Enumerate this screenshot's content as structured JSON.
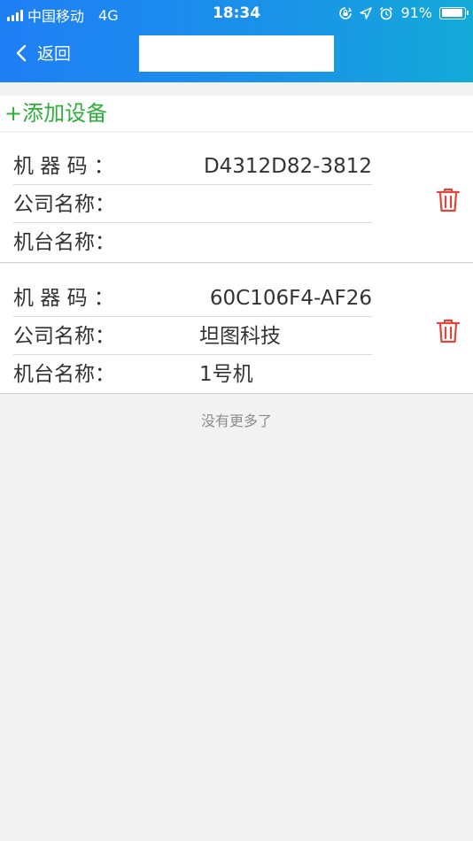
{
  "status_bar": {
    "carrier": "中国移动",
    "network": "4G",
    "time": "18:34",
    "battery": "91%"
  },
  "nav": {
    "back_label": "返回"
  },
  "add_device": {
    "label": "+添加设备"
  },
  "devices": [
    {
      "machine_code_label": "机 器 码 ：",
      "machine_code": "D4312D82-3812",
      "company_label": "公司名称：",
      "company": "",
      "machine_name_label": "机台名称：",
      "machine_name": ""
    },
    {
      "machine_code_label": "机 器 码 ：",
      "machine_code": "60C106F4-AF26",
      "company_label": "公司名称：",
      "company": "坦图科技",
      "machine_name_label": "机台名称：",
      "machine_name": "1号机"
    }
  ],
  "footer": {
    "no_more": "没有更多了"
  },
  "colors": {
    "header_start": "#1e7ff5",
    "header_end": "#13aad8",
    "add_green": "#2fae3c",
    "delete_red": "#e0463c"
  }
}
